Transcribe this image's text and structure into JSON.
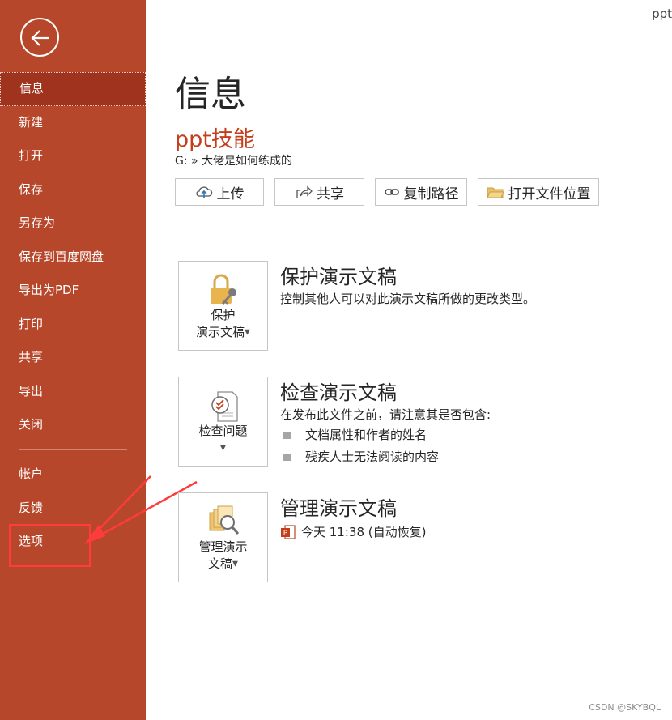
{
  "app": {
    "corner_label": "ppt"
  },
  "colors": {
    "sidebar": "#b7472a",
    "sidebar_active": "#a0331d",
    "doc_title": "#c43e1c",
    "annotation": "#ff3b3b"
  },
  "sidebar": {
    "back_icon": "back-arrow-icon",
    "items": [
      {
        "label": "信息",
        "active": true
      },
      {
        "label": "新建"
      },
      {
        "label": "打开"
      },
      {
        "label": "保存"
      },
      {
        "label": "另存为"
      },
      {
        "label": "保存到百度网盘"
      },
      {
        "label": "导出为PDF"
      },
      {
        "label": "打印"
      },
      {
        "label": "共享"
      },
      {
        "label": "导出"
      },
      {
        "label": "关闭"
      }
    ],
    "bottom_items": [
      {
        "label": "帐户"
      },
      {
        "label": "反馈"
      },
      {
        "label": "选项"
      }
    ]
  },
  "main": {
    "page_title": "信息",
    "doc_title": "ppt技能",
    "doc_path": "G: » 大佬是如何练成的",
    "toolbar": [
      {
        "label": "上传",
        "icon": "upload-cloud-icon"
      },
      {
        "label": "共享",
        "icon": "share-icon"
      },
      {
        "label": "复制路径",
        "icon": "link-icon"
      },
      {
        "label": "打开文件位置",
        "icon": "folder-icon"
      }
    ],
    "protect": {
      "tile_line1": "保护",
      "tile_line2": "演示文稿",
      "title": "保护演示文稿",
      "desc": "控制其他人可以对此演示文稿所做的更改类型。"
    },
    "inspect": {
      "tile_line1": "检查问题",
      "title": "检查演示文稿",
      "desc": "在发布此文件之前，请注意其是否包含:",
      "bullets": [
        "文档属性和作者的姓名",
        "残疾人士无法阅读的内容"
      ]
    },
    "manage": {
      "tile_line1": "管理演示",
      "tile_line2": "文稿",
      "title": "管理演示文稿",
      "autosave": "今天 11:38 (自动恢复)"
    }
  },
  "watermark": "CSDN @SKYBQL"
}
